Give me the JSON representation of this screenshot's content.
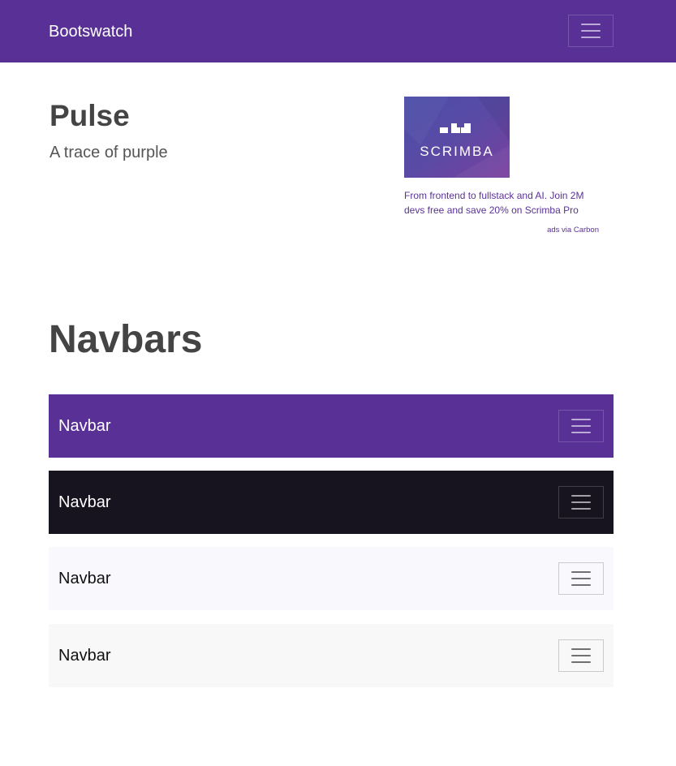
{
  "header": {
    "brand": "Bootswatch",
    "menu_icon": "hamburger-menu-icon",
    "background": "#593196"
  },
  "hero": {
    "title": "Pulse",
    "subtitle": "A trace of purple"
  },
  "ad": {
    "image_text": "SCRIMBA",
    "text": "From frontend to fullstack and AI. Join 2M devs free and save 20% on Scrimba Pro",
    "via": "ads via Carbon"
  },
  "section": {
    "title": "Navbars"
  },
  "navbars": [
    {
      "brand": "Navbar",
      "variant": "primary",
      "background": "#593196"
    },
    {
      "brand": "Navbar",
      "variant": "dark",
      "background": "#17141f"
    },
    {
      "brand": "Navbar",
      "variant": "light",
      "background": "#f9f8fc"
    },
    {
      "brand": "Navbar",
      "variant": "white",
      "background": "#f8f8f8"
    }
  ]
}
